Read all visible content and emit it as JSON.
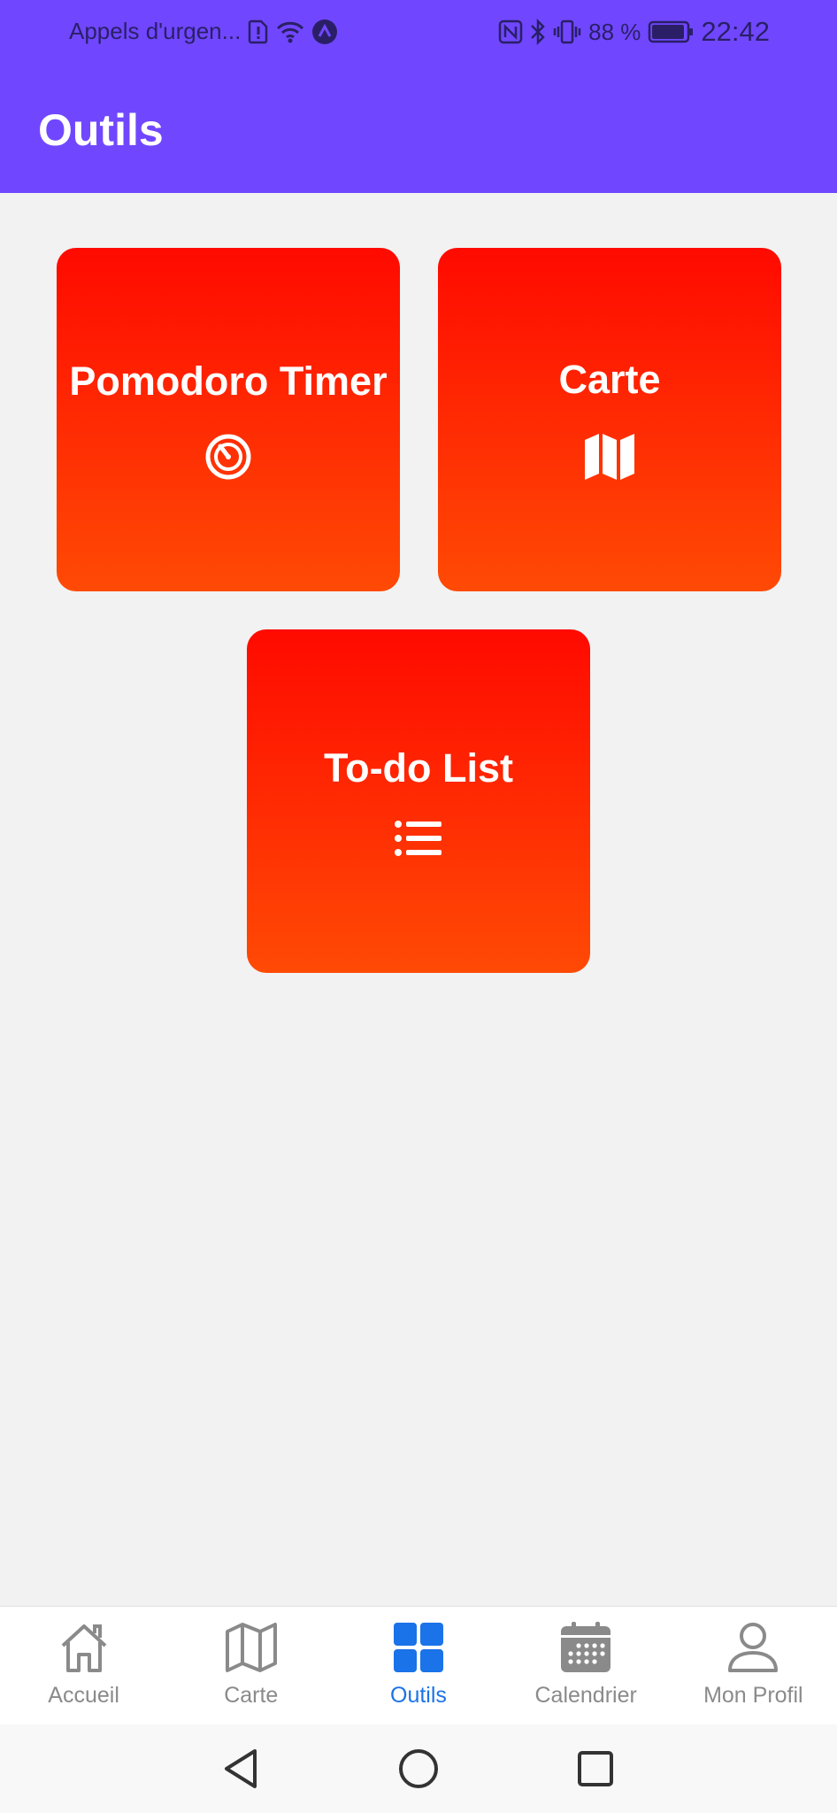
{
  "status_bar": {
    "carrier": "Appels d'urgen...",
    "battery_percent": "88 %",
    "time": "22:42"
  },
  "header": {
    "title": "Outils"
  },
  "tiles": [
    {
      "label": "Pomodoro Timer",
      "icon": "stopwatch-icon"
    },
    {
      "label": "Carte",
      "icon": "map-icon"
    },
    {
      "label": "To-do List",
      "icon": "list-icon"
    }
  ],
  "bottom_nav": {
    "items": [
      {
        "label": "Accueil",
        "icon": "home-icon"
      },
      {
        "label": "Carte",
        "icon": "map-icon"
      },
      {
        "label": "Outils",
        "icon": "grid-icon",
        "active": true
      },
      {
        "label": "Calendrier",
        "icon": "calendar-icon"
      },
      {
        "label": "Mon Profil",
        "icon": "person-icon"
      }
    ]
  },
  "colors": {
    "header": "#7047ff",
    "tile_gradient_top": "#ff0a00",
    "tile_gradient_bottom": "#ff4a05",
    "nav_active": "#1a73e8",
    "nav_inactive": "#8a8a8a",
    "background": "#f2f2f2"
  }
}
